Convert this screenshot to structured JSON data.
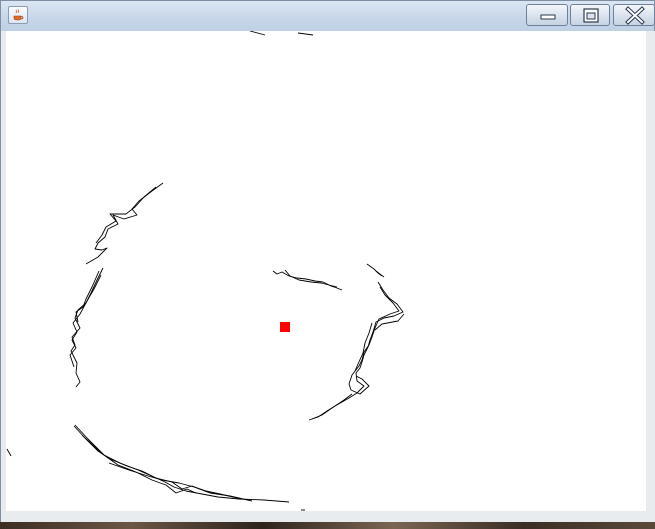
{
  "window": {
    "title": "",
    "icon": "java-cup-icon",
    "controls": {
      "minimize_icon": "minimize-icon",
      "maximize_icon": "maximize-icon",
      "close_icon": "close-icon"
    }
  },
  "canvas": {
    "background": "#ffffff",
    "stroke_color": "#000000",
    "marker_color": "#ff0000"
  }
}
